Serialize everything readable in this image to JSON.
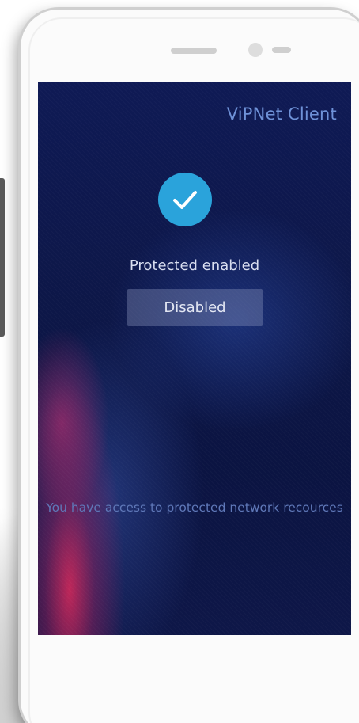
{
  "app": {
    "title": "ViPNet Client"
  },
  "status": {
    "icon": "checkmark-icon",
    "label": "Protected enabled"
  },
  "toggle": {
    "label": "Disabled"
  },
  "footer": {
    "message": "You have access to protected network recources"
  },
  "colors": {
    "accent": "#2aa3db",
    "title": "#6f92d8",
    "background": "#0d1748"
  }
}
